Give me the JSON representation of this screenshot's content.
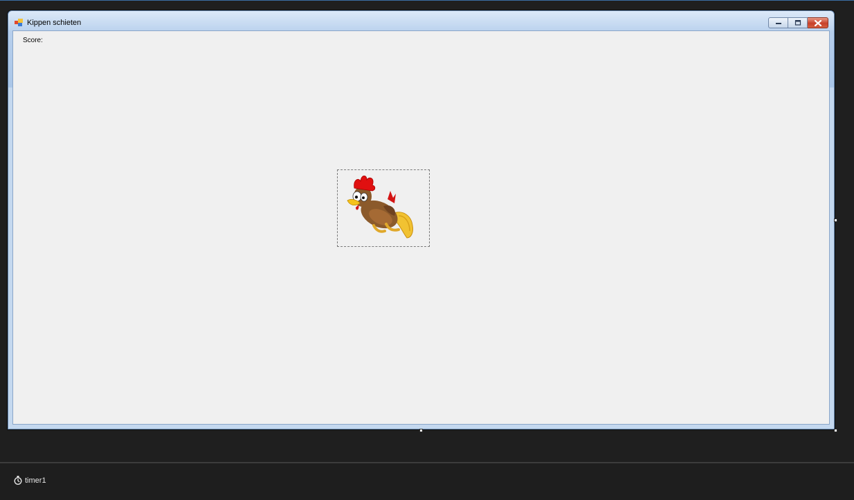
{
  "form": {
    "title": "Kippen schieten",
    "icon": "windows-form-icon"
  },
  "caption_buttons": {
    "minimize_icon": "minimize-icon",
    "maximize_icon": "maximize-icon",
    "close_icon": "close-icon"
  },
  "labels": {
    "score": "Score:"
  },
  "picture_box": {
    "image": "chicken-image"
  },
  "component_tray": {
    "items": [
      {
        "label": "timer1",
        "icon": "timer-icon"
      }
    ]
  },
  "colors": {
    "designer_background": "#1e1e1e",
    "form_client": "#f0f0f0",
    "title_gradient_top": "#dce9f8",
    "close_button": "#c7402a"
  }
}
